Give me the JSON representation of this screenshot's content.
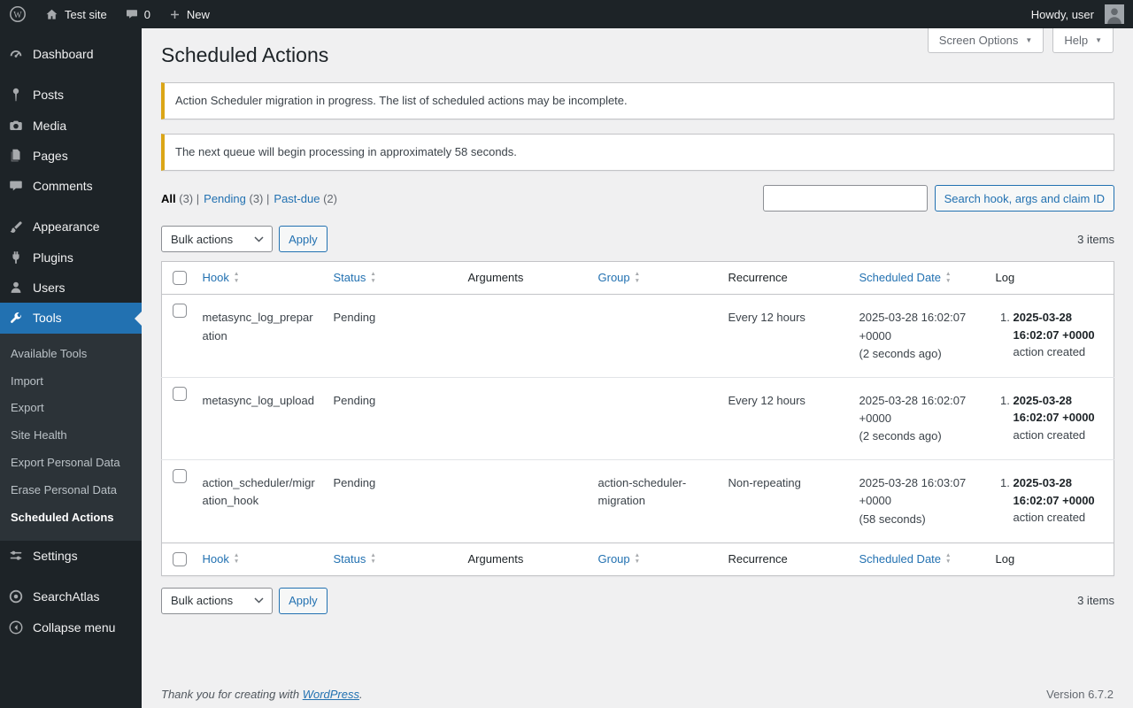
{
  "colors": {
    "accent": "#2271b1",
    "admin_bar_bg": "#1d2327",
    "content_bg": "#f0f0f1",
    "notice_accent": "#dba617"
  },
  "admin_bar": {
    "site_name": "Test site",
    "comments_count": "0",
    "new_label": "New",
    "howdy": "Howdy, user"
  },
  "sidebar": {
    "items": [
      "Dashboard",
      "Posts",
      "Media",
      "Pages",
      "Comments",
      "Appearance",
      "Plugins",
      "Users",
      "Tools",
      "Settings",
      "SearchAtlas"
    ],
    "collapse_label": "Collapse menu",
    "tools_submenu": [
      "Available Tools",
      "Import",
      "Export",
      "Site Health",
      "Export Personal Data",
      "Erase Personal Data",
      "Scheduled Actions"
    ]
  },
  "screen_meta": {
    "screen_options": "Screen Options",
    "help": "Help"
  },
  "page": {
    "title": "Scheduled Actions",
    "notice_migration": "Action Scheduler migration in progress. The list of scheduled actions may be incomplete.",
    "notice_queue": "The next queue will begin processing in approximately 58 seconds.",
    "filters": [
      {
        "label": "All",
        "count": "(3)"
      },
      {
        "label": "Pending",
        "count": "(3)"
      },
      {
        "label": "Past-due",
        "count": "(2)"
      }
    ],
    "filter_separator": "|",
    "search_button": "Search hook, args and claim ID",
    "bulk_actions": "Bulk actions",
    "apply": "Apply",
    "items_count": "3 items"
  },
  "table": {
    "columns": [
      {
        "label": "Hook",
        "sortable": true
      },
      {
        "label": "Status",
        "sortable": true
      },
      {
        "label": "Arguments",
        "sortable": false
      },
      {
        "label": "Group",
        "sortable": true
      },
      {
        "label": "Recurrence",
        "sortable": false
      },
      {
        "label": "Scheduled Date",
        "sortable": true
      },
      {
        "label": "Log",
        "sortable": false
      }
    ],
    "rows": [
      {
        "hook": "metasync_log_preparation",
        "status": "Pending",
        "arguments": "",
        "group": "",
        "recurrence": "Every 12 hours",
        "scheduled_date": "2025-03-28 16:02:07 +0000",
        "scheduled_relative": "(2 seconds ago)",
        "log_date": "2025-03-28 16:02:07 +0000",
        "log_text": "action created"
      },
      {
        "hook": "metasync_log_upload",
        "status": "Pending",
        "arguments": "",
        "group": "",
        "recurrence": "Every 12 hours",
        "scheduled_date": "2025-03-28 16:02:07 +0000",
        "scheduled_relative": "(2 seconds ago)",
        "log_date": "2025-03-28 16:02:07 +0000",
        "log_text": "action created"
      },
      {
        "hook": "action_scheduler/migration_hook",
        "status": "Pending",
        "arguments": "",
        "group": "action-scheduler-migration",
        "recurrence": "Non-repeating",
        "scheduled_date": "2025-03-28 16:03:07 +0000",
        "scheduled_relative": "(58 seconds)",
        "log_date": "2025-03-28 16:02:07 +0000",
        "log_text": "action created"
      }
    ]
  },
  "footer": {
    "thankyou": "Thank you for creating with",
    "wordpress": "WordPress",
    "period": ".",
    "version": "Version 6.7.2"
  }
}
